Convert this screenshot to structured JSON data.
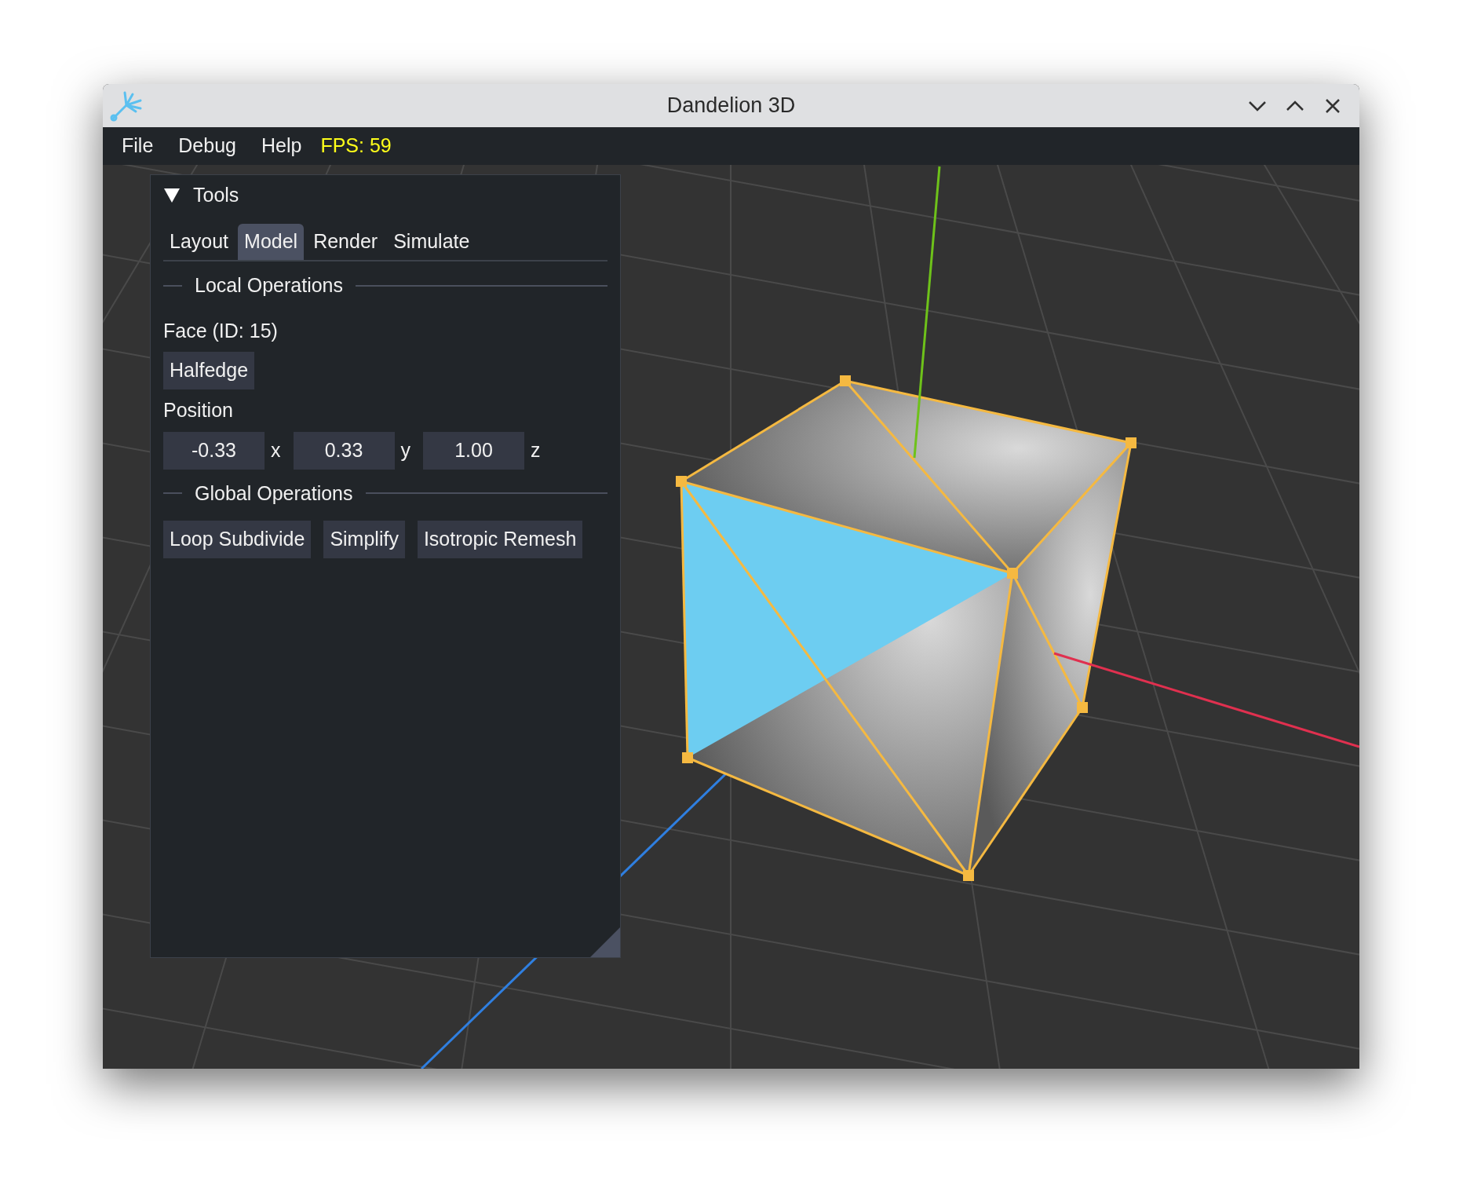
{
  "window": {
    "title": "Dandelion 3D"
  },
  "menu": {
    "items": [
      "File",
      "Debug",
      "Help"
    ],
    "fps": "FPS: 59"
  },
  "tools_panel": {
    "title": "Tools",
    "expanded": true,
    "tabs": [
      {
        "label": "Layout",
        "selected": false
      },
      {
        "label": "Model",
        "selected": true
      },
      {
        "label": "Render",
        "selected": false
      },
      {
        "label": "Simulate",
        "selected": false
      }
    ],
    "local_operations": {
      "heading": "Local Operations",
      "element": "Face (ID: 15)",
      "button": "Halfedge",
      "position_label": "Position",
      "position": [
        {
          "value": "-0.33",
          "axis": "x"
        },
        {
          "value": "0.33",
          "axis": "y"
        },
        {
          "value": "1.00",
          "axis": "z"
        }
      ]
    },
    "global_operations": {
      "heading": "Global Operations",
      "buttons": [
        "Loop Subdivide",
        "Simplify",
        "Isotropic Remesh"
      ]
    }
  }
}
